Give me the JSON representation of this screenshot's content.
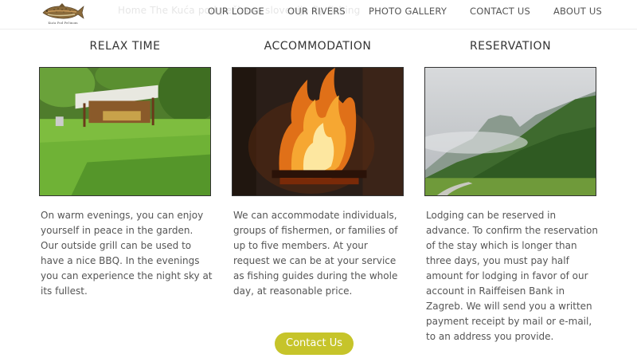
{
  "header": {
    "logo_caption": "Kuća Pod Pečinom",
    "ghost_text": "Home  The  Kuća pod pečinom  slovenija  fly fishing",
    "nav": [
      {
        "label": "OUR LODGE"
      },
      {
        "label": "OUR RIVERS"
      },
      {
        "label": "PHOTO GALLERY"
      },
      {
        "label": "CONTACT US"
      },
      {
        "label": "ABOUT US"
      }
    ]
  },
  "columns": [
    {
      "title": "RELAX TIME",
      "text": "On warm evenings, you can enjoy yourself in peace in the garden. Our outside grill can be used to have a nice BBQ. In the evenings you can experience the night sky at its fullest."
    },
    {
      "title": "ACCOMMODATION",
      "text": "We can accommodate individuals, groups of fishermen, or families of up to five members. At your request we can be at your service as fishing guides during the whole day, at reasonable price."
    },
    {
      "title": "RESERVATION",
      "text": "Lodging can be reserved in advance. To confirm the reservation of the stay which is longer than three days, you must pay half amount for lodging in favor of our account in Raiffeisen Bank in Zagreb. We will send you a written payment receipt by mail or e-mail, to an address you provide."
    }
  ],
  "cta": {
    "label": "Contact Us"
  },
  "colors": {
    "accent": "#c6c42a",
    "text": "#555555"
  },
  "icons": {
    "logo": "trout-fish-logo"
  }
}
